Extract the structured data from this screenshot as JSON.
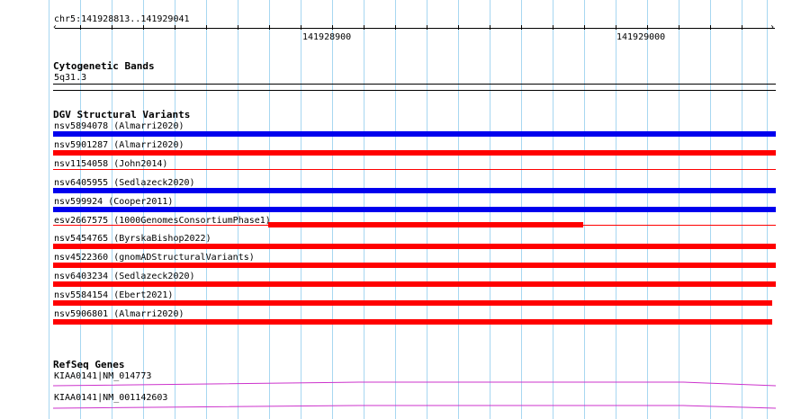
{
  "ruler": {
    "location": "chr5:141928813..141929041",
    "tick_labels": [
      "141928900",
      "141929000"
    ]
  },
  "cytoband": {
    "title": "Cytogenetic Bands",
    "band": "5q31.3"
  },
  "dgv": {
    "title": "DGV Structural Variants",
    "variants": [
      {
        "label": "nsv5894078 (Almarri2020)",
        "color": "#0000ee",
        "type": "loss",
        "full": true
      },
      {
        "label": "nsv5901287 (Almarri2020)",
        "color": "#ff0000",
        "type": "gain",
        "full": true
      },
      {
        "label": "nsv1154058 (John2014)",
        "color": "#ff0000",
        "type": "gain",
        "full": true
      },
      {
        "label": "nsv6405955 (Sedlazeck2020)",
        "color": "#0000ee",
        "type": "loss",
        "full": true
      },
      {
        "label": "nsv599924 (Cooper2011)",
        "color": "#0000ee",
        "type": "loss",
        "full": true
      },
      {
        "label": "esv2667575 (1000GenomesConsortiumPhase1)",
        "color": "#ff0000",
        "type": "gain",
        "full": false
      },
      {
        "label": "nsv5454765 (ByrskaBishop2022)",
        "color": "#ff0000",
        "type": "gain",
        "full": true
      },
      {
        "label": "nsv4522360 (gnomADStructuralVariants)",
        "color": "#ff0000",
        "type": "gain",
        "full": true
      },
      {
        "label": "nsv6403234 (Sedlazeck2020)",
        "color": "#ff0000",
        "type": "gain",
        "full": true
      },
      {
        "label": "nsv5584154 (Ebert2021)",
        "color": "#ff0000",
        "type": "gain",
        "full": true
      },
      {
        "label": "nsv5906801 (Almarri2020)",
        "color": "#ff0000",
        "type": "gain",
        "full": true
      }
    ]
  },
  "refseq": {
    "title": "RefSeq Genes",
    "genes": [
      {
        "label": "KIAA0141|NM_014773",
        "color": "#cc33cc"
      },
      {
        "label": "KIAA0141|NM_001142603",
        "color": "#cc33cc"
      }
    ]
  }
}
